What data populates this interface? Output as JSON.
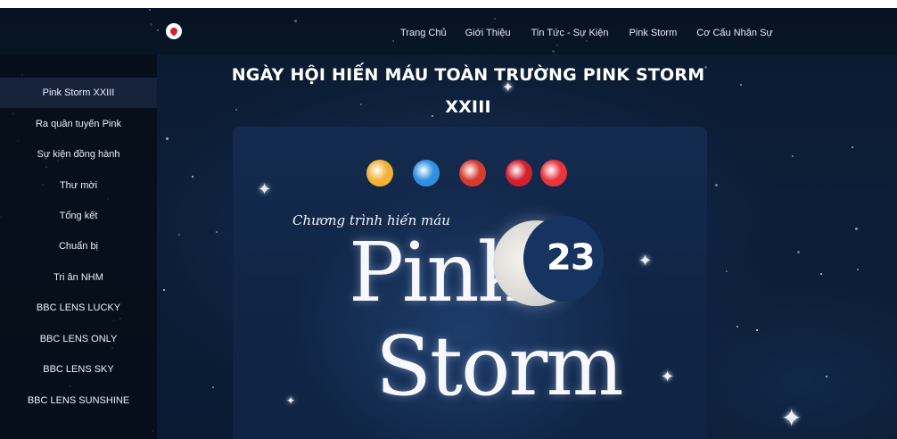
{
  "nav": {
    "links": [
      "Trang Chủ",
      "Giới Thiệu",
      "Tin Tức - Sự Kiện",
      "Pink Storm",
      "Cơ Cấu Nhân Sự"
    ]
  },
  "sidebar": {
    "items": [
      {
        "label": "Pink Storm XXIII",
        "active": true
      },
      {
        "label": "Ra quân tuyến Pink",
        "active": false
      },
      {
        "label": "Sự kiện đồng hành",
        "active": false
      },
      {
        "label": "Thư mời",
        "active": false
      },
      {
        "label": "Tổng kết",
        "active": false
      },
      {
        "label": "Chuẩn bị",
        "active": false
      },
      {
        "label": "Tri ân NHM",
        "active": false
      },
      {
        "label": "BBC LENS LUCKY",
        "active": false
      },
      {
        "label": "BBC LENS ONLY",
        "active": false
      },
      {
        "label": "BBC LENS SKY",
        "active": false
      },
      {
        "label": "BBC LENS SUNSHINE",
        "active": false
      }
    ]
  },
  "main": {
    "title": "NGÀY HỘI HIẾN MÁU TOÀN TRƯỜNG PINK STORM XXIII"
  },
  "poster": {
    "program_label": "Chương trình hiến máu",
    "word_pink": "Pink",
    "word_storm": "Storm",
    "year_badge": "23",
    "sponsor_logos": [
      {
        "icon": "yellow-emblem-icon",
        "color": "#f2b233"
      },
      {
        "icon": "blue-emblem-icon",
        "color": "#2f8fe0"
      },
      {
        "icon": "youth-union-icon",
        "color": "#d63b2f"
      },
      {
        "icon": "red-ribbon-knot-icon",
        "color": "#d3202f"
      },
      {
        "icon": "blood-drop-icon",
        "color": "#e8343b"
      }
    ]
  },
  "colors": {
    "background": "#0c1e38",
    "sidebar": "#060c16",
    "sidebar_active": "#16233b",
    "text": "#ffffff"
  }
}
